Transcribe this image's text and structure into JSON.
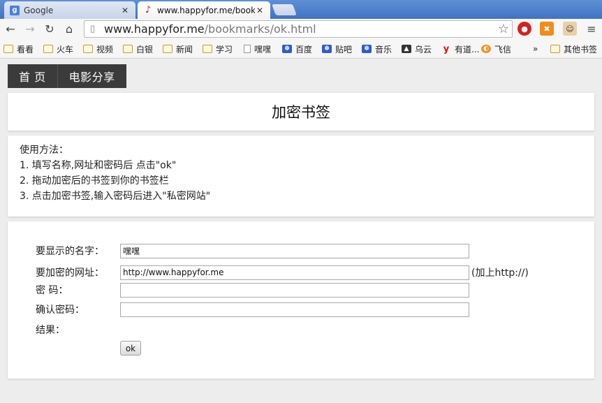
{
  "browser": {
    "tabs": [
      {
        "title": "Google",
        "favicon": "g"
      },
      {
        "title": "www.happyfor.me/book",
        "favicon": "happyfor-icon"
      }
    ],
    "url_host": "www.happyfor.me",
    "url_path": "/bookmarks/ok.html",
    "bookmarks": [
      "看看",
      "火车",
      "视频",
      "白银",
      "新闻",
      "学习",
      "嘿嘿",
      "百度",
      "贴吧",
      "音乐",
      "乌云",
      "有道...",
      "飞信"
    ],
    "bookmarks_more": "»",
    "other_bookmarks": "其他书签"
  },
  "page": {
    "nav": [
      "首 页",
      "电影分享"
    ],
    "title": "加密书签",
    "usage": {
      "heading": "使用方法：",
      "steps": [
        "1.  填写名称,网址和密码后 点击\"ok\"",
        "2.  拖动加密后的书签到你的书签栏",
        "3.  点击加密书签,输入密码后进入\"私密网站\""
      ]
    },
    "form": {
      "name_label": "要显示的名字：",
      "name_value": "嘿嘿",
      "url_label": "要加密的网址：",
      "url_value": "http://www.happyfor.me",
      "url_hint": "(加上http://)",
      "password_label": "密  码：",
      "password_value": "",
      "confirm_label": "确认密码：",
      "confirm_value": "",
      "result_label": "结果：",
      "ok_label": "ok"
    }
  }
}
